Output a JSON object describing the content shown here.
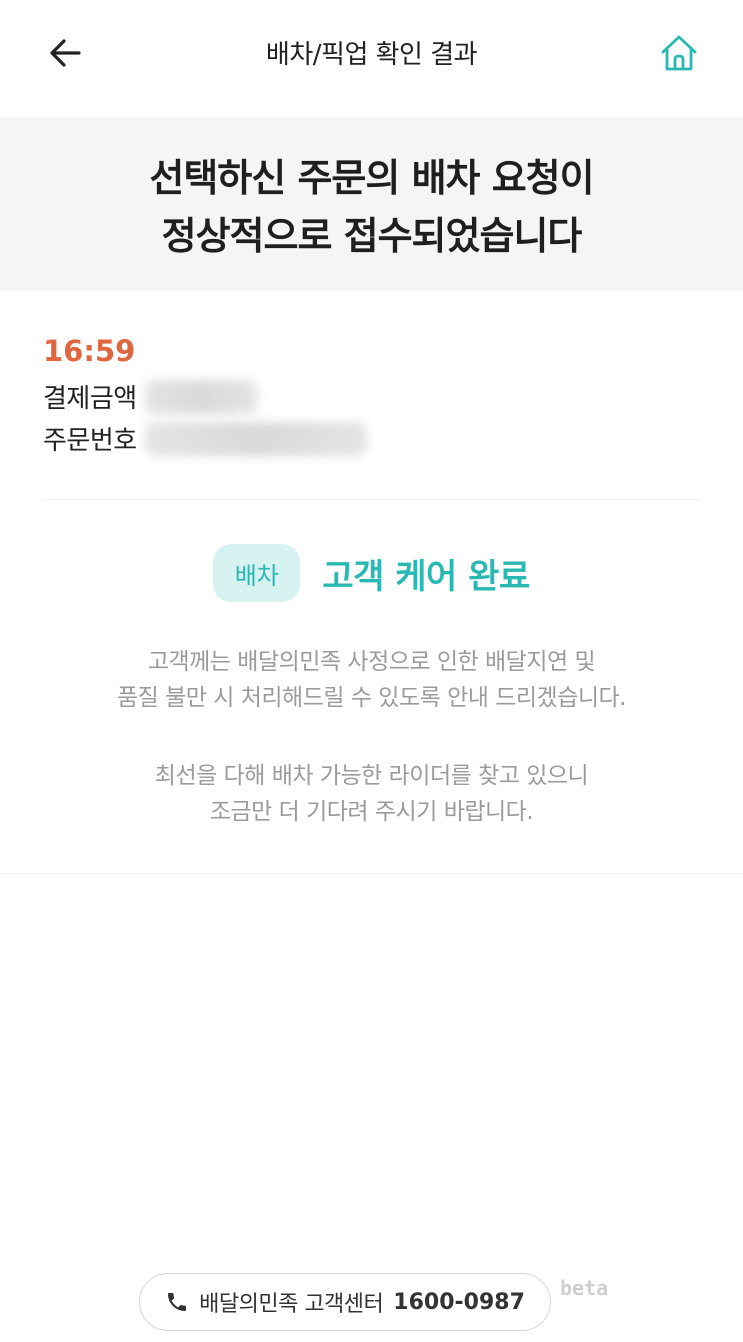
{
  "header": {
    "title": "배차/픽업 확인 결과",
    "back_icon": "arrow-left-icon",
    "home_icon": "home-icon"
  },
  "banner": {
    "line1": "선택하신 주문의 배차 요청이",
    "line2": "정상적으로 접수되었습니다"
  },
  "order": {
    "time": "16:59",
    "amount_label": "결제금액",
    "order_number_label": "주문번호"
  },
  "status": {
    "badge": "배차",
    "text": "고객 케어 완료"
  },
  "description": {
    "p1_line1": "고객께는 배달의민족 사정으로 인한 배달지연 및",
    "p1_line2": "품질 불만 시 처리해드릴 수 있도록 안내 드리겠습니다.",
    "p2_line1": "최선을 다해 배차 가능한 라이더를 찾고 있으니",
    "p2_line2": "조금만 더 기다려 주시기 바랍니다."
  },
  "footer": {
    "cs_label": "배달의민족 고객센터",
    "cs_number": "1600-0987",
    "phone_icon": "phone-icon",
    "beta": "beta"
  },
  "colors": {
    "accent": "#2ab9b2",
    "time": "#e0663f",
    "badge_bg": "#d6f3f2",
    "banner_bg": "#f5f5f5",
    "muted_text": "#9b9b9b"
  }
}
